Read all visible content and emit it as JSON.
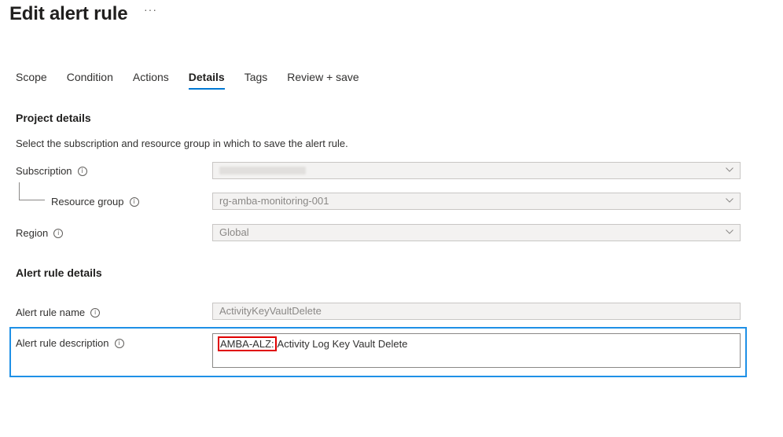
{
  "page": {
    "title": "Edit alert rule",
    "more": "···"
  },
  "tabs": [
    {
      "label": "Scope"
    },
    {
      "label": "Condition"
    },
    {
      "label": "Actions"
    },
    {
      "label": "Details"
    },
    {
      "label": "Tags"
    },
    {
      "label": "Review + save"
    }
  ],
  "active_tab": "Details",
  "project": {
    "title": "Project details",
    "description": "Select the subscription and resource group in which to save the alert rule.",
    "subscription_label": "Subscription",
    "resource_group_label": "Resource group",
    "resource_group_value": "rg-amba-monitoring-001",
    "region_label": "Region",
    "region_value": "Global"
  },
  "alert": {
    "title": "Alert rule details",
    "name_label": "Alert rule name",
    "name_value": "ActivityKeyVaultDelete",
    "description_label": "Alert rule description",
    "description_prefix": "AMBA-ALZ:",
    "description_rest": " Activity Log Key Vault Delete"
  },
  "icons": {
    "info": "info-icon",
    "chevron": "chevron-down-icon",
    "more": "more-icon"
  },
  "colors": {
    "accent": "#0078d4",
    "highlight_red": "#e00000",
    "highlight_blue": "#1e90e6"
  }
}
